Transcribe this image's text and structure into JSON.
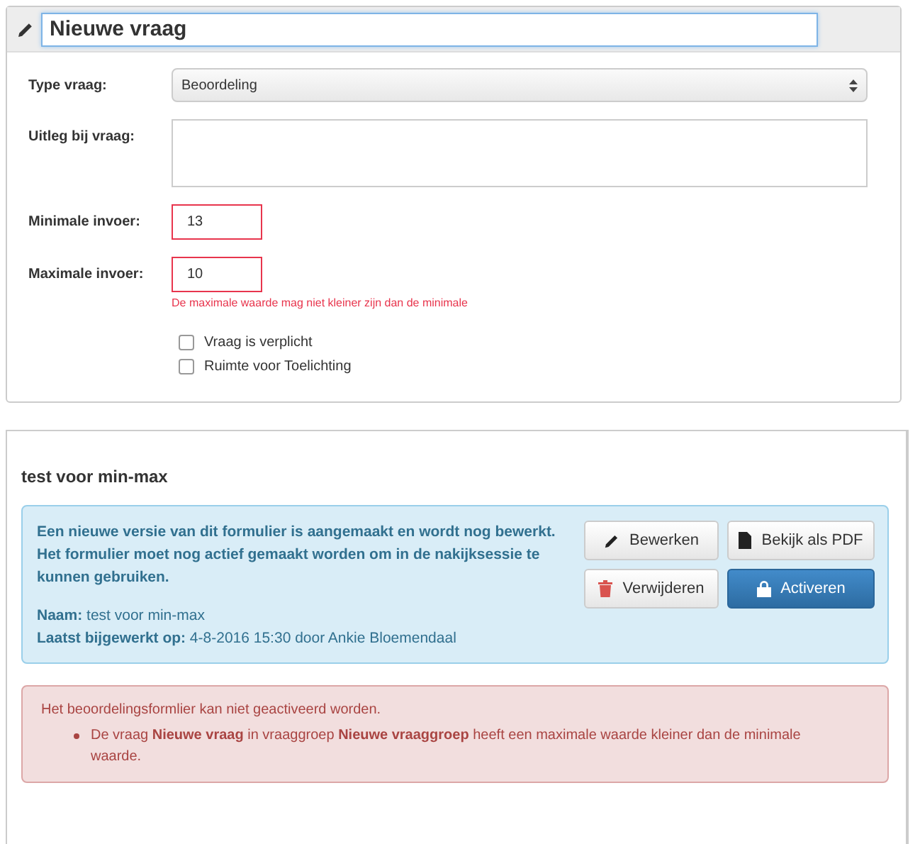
{
  "question_panel": {
    "title_value": "Nieuwe vraag",
    "fields": [
      {
        "kind": "select",
        "label": "Type vraag:",
        "value": "Beoordeling"
      },
      {
        "kind": "textarea",
        "label": "Uitleg bij vraag:"
      },
      {
        "kind": "number",
        "label": "Minimale invoer:",
        "value": "13",
        "invalid": true
      },
      {
        "kind": "number",
        "label": "Maximale invoer:",
        "value": "10",
        "invalid": true,
        "error": "De maximale waarde mag niet kleiner zijn dan de minimale"
      }
    ],
    "checkboxes": [
      {
        "label": "Vraag is verplicht",
        "checked": false
      },
      {
        "label": "Ruimte voor Toelichting",
        "checked": false
      }
    ]
  },
  "form_panel": {
    "title": "test voor min-max",
    "info": {
      "message": "Een nieuwe versie van dit formulier is aangemaakt en wordt nog bewerkt. Het formulier moet nog actief gemaakt worden om in de nakijksessie te kunnen gebruiken.",
      "details": [
        {
          "label": "Naam:",
          "value": "test voor min-max"
        },
        {
          "label": "Laatst bijgewerkt op:",
          "value": "4-8-2016 15:30 door Ankie Bloemendaal"
        }
      ],
      "buttons": [
        {
          "kind": "edit",
          "label": "Bewerken",
          "primary": false
        },
        {
          "kind": "pdf",
          "label": "Bekijk als PDF",
          "primary": false
        },
        {
          "kind": "delete",
          "label": "Verwijderen",
          "primary": false
        },
        {
          "kind": "activate",
          "label": "Activeren",
          "primary": true
        }
      ]
    },
    "error": {
      "message": "Het beoordelingsformlier kan niet geactiveerd worden.",
      "items": [
        "De vraag **Nieuwe vraag** in vraaggroep **Nieuwe vraaggroep** heeft een maximale waarde kleiner dan de minimale waarde."
      ]
    }
  }
}
